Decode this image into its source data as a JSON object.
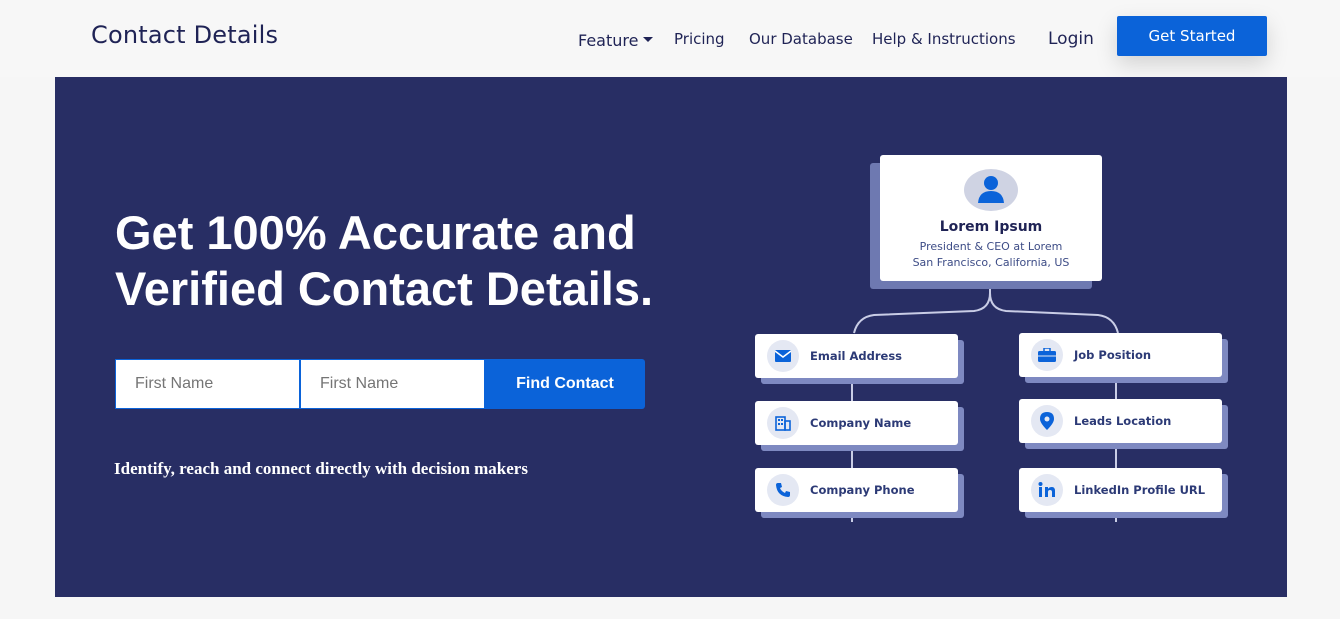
{
  "nav": {
    "brand": "Contact Details",
    "feature": "Feature",
    "pricing": "Pricing",
    "database": "Our Database",
    "help": "Help & Instructions",
    "login": "Login",
    "cta": "Get Started"
  },
  "hero": {
    "headline_line1": "Get 100% Accurate and",
    "headline_line2": "Verified Contact Details.",
    "input1_placeholder": "First Name",
    "input2_placeholder": "First Name",
    "find_button": "Find Contact",
    "subtext": "Identify, reach and connect directly with decision makers"
  },
  "diagram": {
    "name": "Lorem Ipsum",
    "title": "President & CEO at Lorem",
    "location": "San Francisco, California, US",
    "fields_left": [
      "Email Address",
      "Company Name",
      "Company Phone"
    ],
    "fields_right": [
      "Job Position",
      "Leads Location",
      "LinkedIn Profile URL"
    ],
    "icons_left": [
      "email-icon",
      "building-icon",
      "phone-icon"
    ],
    "icons_right": [
      "briefcase-icon",
      "location-pin-icon",
      "linkedin-icon"
    ]
  },
  "colors": {
    "accent": "#0b63d9",
    "hero_bg": "#282e64",
    "nav_text": "#1f2355"
  }
}
